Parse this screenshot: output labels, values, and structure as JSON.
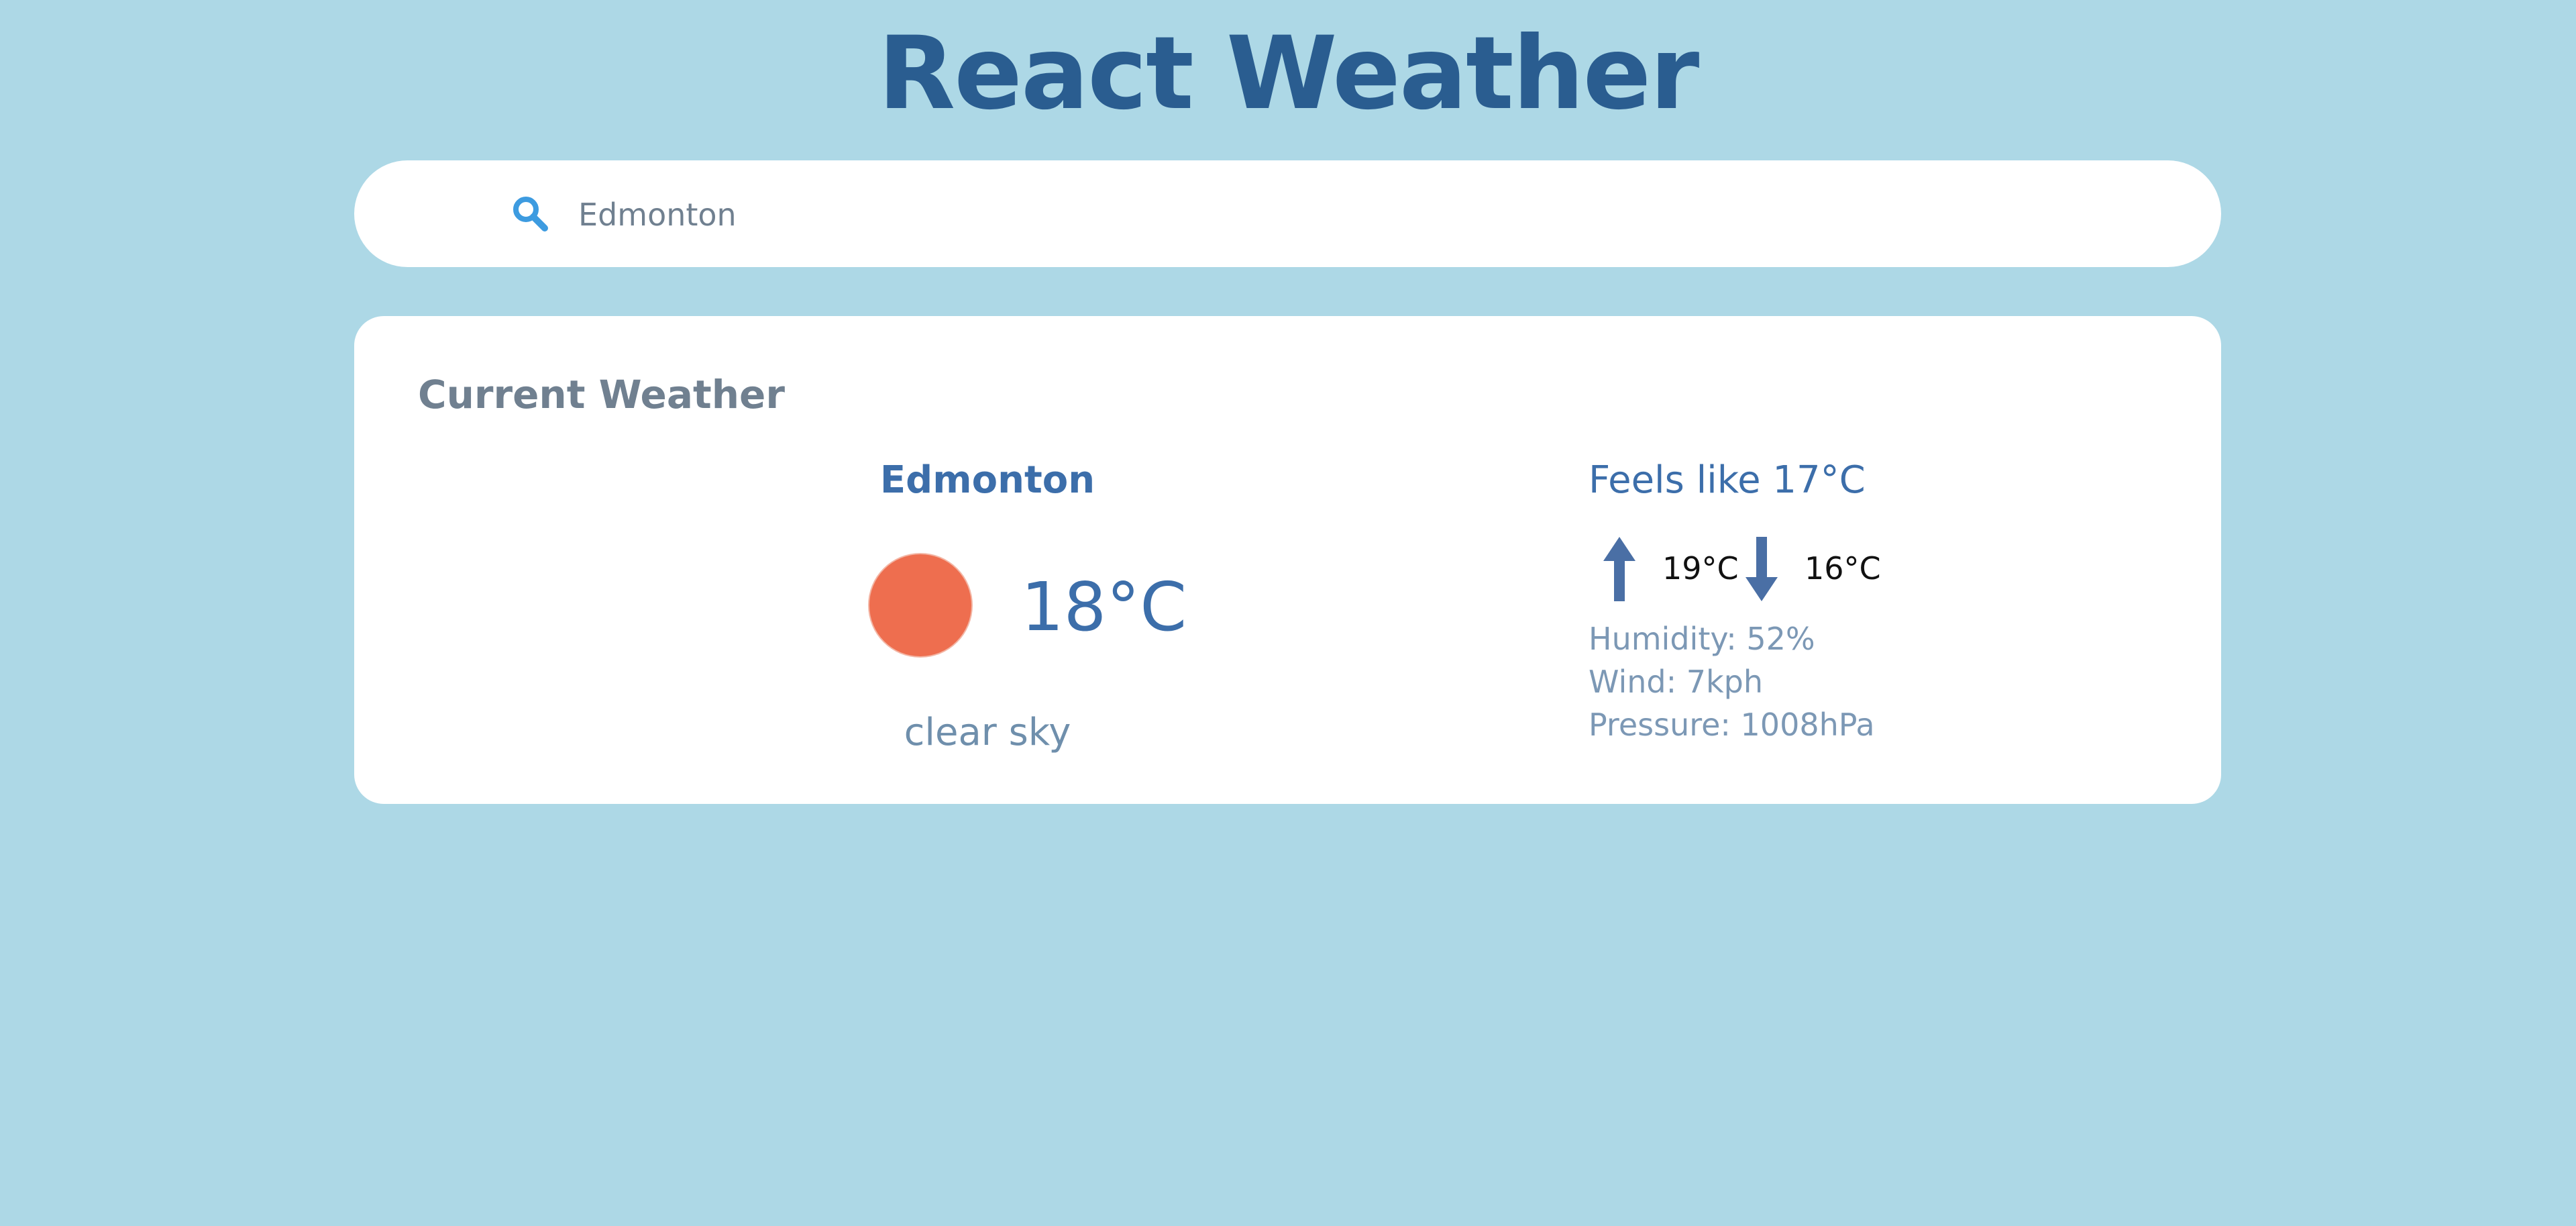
{
  "app": {
    "title": "React Weather"
  },
  "search": {
    "value": "Edmonton",
    "icon": "search-icon"
  },
  "current_weather": {
    "heading": "Current Weather",
    "city": "Edmonton",
    "temperature": "18°C",
    "condition_icon": "sun-icon",
    "description": "clear sky",
    "feels_like": "Feels like 17°C",
    "high": "19°C",
    "low": "16°C",
    "humidity": "Humidity: 52%",
    "wind": "Wind: 7kph",
    "pressure": "Pressure: 1008hPa"
  },
  "colors": {
    "background": "#add8e6",
    "title": "#2a5d90",
    "accent": "#3c6eaa",
    "sun": "#ee6e4f",
    "search_icon": "#3d9be0"
  }
}
